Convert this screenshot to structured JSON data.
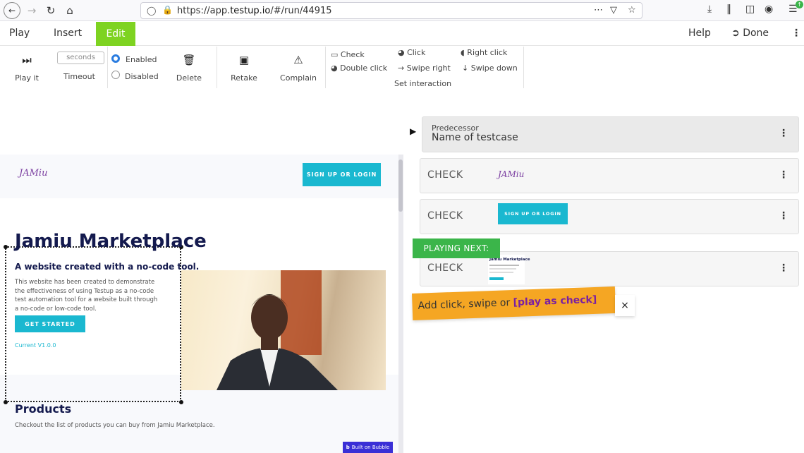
{
  "browser": {
    "url": "https://app.testup.io/#/run/44915",
    "url_host": "https://app.",
    "url_domain": "testup.io",
    "url_path": "/#/run/44915"
  },
  "menu": {
    "play": "Play",
    "insert": "Insert",
    "edit": "Edit",
    "help": "Help",
    "done": "Done"
  },
  "toolbar": {
    "play_it": "Play it",
    "timeout_placeholder": "seconds",
    "timeout": "Timeout",
    "enabled": "Enabled",
    "disabled": "Disabled",
    "delete": "Delete",
    "retake": "Retake",
    "complain": "Complain",
    "check": "Check",
    "double_click": "Double click",
    "click": "Click",
    "swipe_right": "Swipe right",
    "right_click": "Right click",
    "swipe_down": "Swipe down",
    "set_interaction": "Set interaction"
  },
  "preview": {
    "logo": "JAMiu",
    "header_button": "SIGN UP OR LOGIN",
    "hero_title": "Jamiu Marketplace",
    "hero_subtitle": "A website created with a no-code tool.",
    "hero_desc": "This website has been created to demonstrate the effectiveness of using Testup as a no-code test automation tool for a website built through a no-code or low-code tool.",
    "hero_button": "GET STARTED",
    "hero_version": "Current V1.0.0",
    "products_title": "Products",
    "products_desc": "Checkout the list of products you can buy from Jamiu Marketplace.",
    "bubble_badge": "Built on Bubble"
  },
  "steps": {
    "predecessor_label": "Predecessor",
    "predecessor_name": "Name of testcase",
    "items": [
      {
        "kind": "CHECK",
        "thumb_logo": "JAMiu"
      },
      {
        "kind": "CHECK",
        "thumb_button": "SIGN UP OR LOGIN"
      },
      {
        "kind": "CHECK",
        "thumb_title": "Jamiu Marketplace"
      }
    ],
    "playing_next": "PLAYING NEXT:"
  },
  "hint": {
    "text": "Add click, swipe or ",
    "emphasis": "[play as check]",
    "close": "×"
  },
  "colors": {
    "edit_tab": "#7ed321",
    "accent_button": "#1ab8d0",
    "playing_next": "#3bb54a",
    "hint_bg": "#f5a623",
    "hero_title": "#141a4e"
  }
}
